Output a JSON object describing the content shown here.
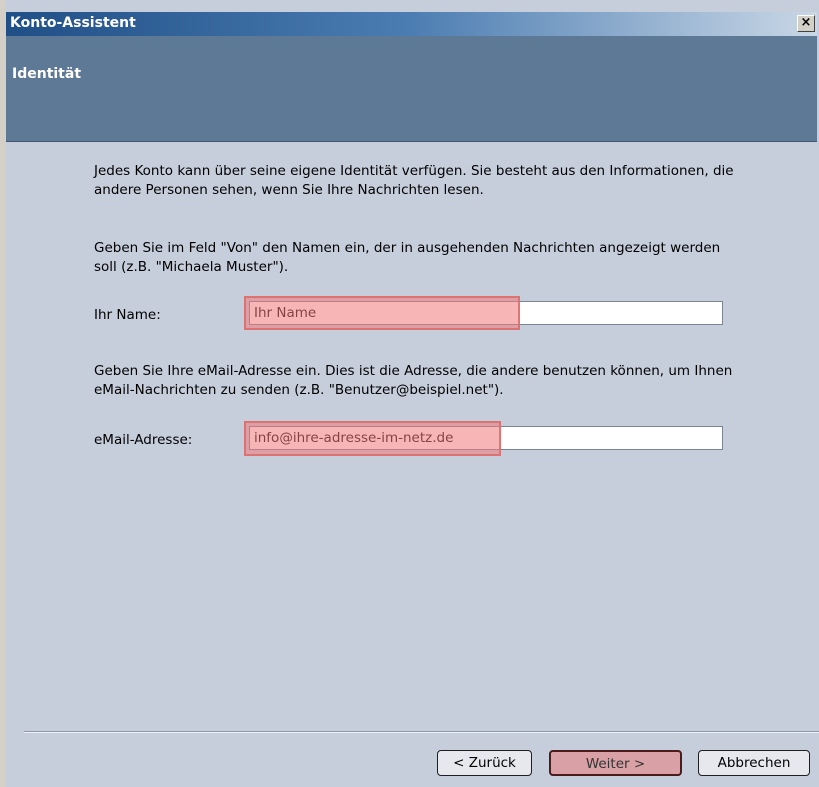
{
  "window": {
    "title": "Konto-Assistent",
    "close_label": "×"
  },
  "header": {
    "title": "Identität"
  },
  "content": {
    "intro_text": "Jedes Konto kann über seine eigene Identität verfügen. Sie besteht aus den Informationen, die andere Personen sehen, wenn Sie Ihre Nachrichten lesen.",
    "name_help_text": "Geben Sie im Feld \"Von\" den Namen ein, der in ausgehenden Nachrichten angezeigt werden soll (z.B. \"Michaela Muster\").",
    "name_label": "Ihr Name:",
    "name_value": "Ihr Name",
    "email_help_text": "Geben Sie Ihre eMail-Adresse ein. Dies ist die Adresse, die andere benutzen können, um Ihnen eMail-Nachrichten zu senden (z.B. \"Benutzer@beispiel.net\").",
    "email_label": "eMail-Adresse:",
    "email_value": "info@ihre-adresse-im-netz.de"
  },
  "buttons": {
    "back": "< Zurück",
    "next": "Weiter >",
    "cancel": "Abbrechen"
  }
}
